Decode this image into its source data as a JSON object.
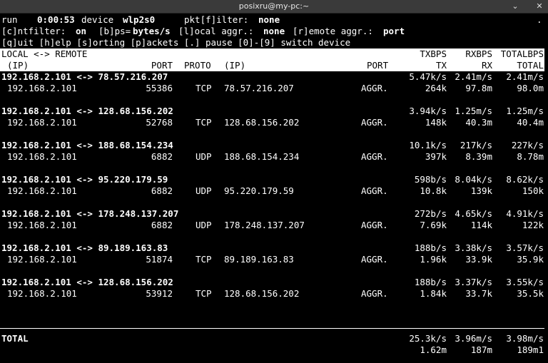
{
  "window": {
    "title": "posixru@my-pc:~",
    "minimize_label": "⌄",
    "close_label": "✕"
  },
  "status": {
    "state": "run",
    "elapsed": "0:00:53",
    "device_label": "device",
    "device": "wlp2s0",
    "pktfilter_label": "pkt[f]ilter:",
    "pktfilter": "none",
    "dot": "."
  },
  "options": {
    "cntfilter_label": "[c]ntfilter:",
    "cntfilter": "on",
    "bps_label": "[b]ps=",
    "bps": "bytes/s",
    "local_aggr_label": "[l]ocal aggr.:",
    "local_aggr": "none",
    "remote_aggr_label": "[r]emote aggr.:",
    "remote_aggr": "port"
  },
  "keys": {
    "help": "[q]uit [h]elp [s]orting [p]ackets [.] pause [0]-[9] switch device"
  },
  "header": {
    "local_remote": "LOCAL <-> REMOTE",
    "txbps": "TXBPS",
    "rxbps": "RXBPS",
    "totalbps": "TOTALBPS",
    "ip_local": "(IP)",
    "port_local": "PORT",
    "proto": "PROTO",
    "ip_remote": "(IP)",
    "port_remote": "PORT",
    "tx": "TX",
    "rx": "RX",
    "total": "TOTAL"
  },
  "connections": [
    {
      "pair": "192.168.2.101 <-> 78.57.216.207",
      "txbps": "5.47k/s",
      "rxbps": "2.41m/s",
      "totalbps": "2.41m/s",
      "local_ip": "192.168.2.101",
      "local_port": "55386",
      "proto": "TCP",
      "remote_ip": "78.57.216.207",
      "remote_port": "AGGR.",
      "tx": "264k",
      "rx": "97.8m",
      "total": "98.0m"
    },
    {
      "pair": "192.168.2.101 <-> 128.68.156.202",
      "txbps": "3.94k/s",
      "rxbps": "1.25m/s",
      "totalbps": "1.25m/s",
      "local_ip": "192.168.2.101",
      "local_port": "52768",
      "proto": "TCP",
      "remote_ip": "128.68.156.202",
      "remote_port": "AGGR.",
      "tx": "148k",
      "rx": "40.3m",
      "total": "40.4m"
    },
    {
      "pair": "192.168.2.101 <-> 188.68.154.234",
      "txbps": "10.1k/s",
      "rxbps": "217k/s",
      "totalbps": "227k/s",
      "local_ip": "192.168.2.101",
      "local_port": "6882",
      "proto": "UDP",
      "remote_ip": "188.68.154.234",
      "remote_port": "AGGR.",
      "tx": "397k",
      "rx": "8.39m",
      "total": "8.78m"
    },
    {
      "pair": "192.168.2.101 <-> 95.220.179.59",
      "txbps": "598b/s",
      "rxbps": "8.04k/s",
      "totalbps": "8.62k/s",
      "local_ip": "192.168.2.101",
      "local_port": "6882",
      "proto": "UDP",
      "remote_ip": "95.220.179.59",
      "remote_port": "AGGR.",
      "tx": "10.8k",
      "rx": "139k",
      "total": "150k"
    },
    {
      "pair": "192.168.2.101 <-> 178.248.137.207",
      "txbps": "272b/s",
      "rxbps": "4.65k/s",
      "totalbps": "4.91k/s",
      "local_ip": "192.168.2.101",
      "local_port": "6882",
      "proto": "UDP",
      "remote_ip": "178.248.137.207",
      "remote_port": "AGGR.",
      "tx": "7.69k",
      "rx": "114k",
      "total": "122k"
    },
    {
      "pair": "192.168.2.101 <-> 89.189.163.83",
      "txbps": "188b/s",
      "rxbps": "3.38k/s",
      "totalbps": "3.57k/s",
      "local_ip": "192.168.2.101",
      "local_port": "51874",
      "proto": "TCP",
      "remote_ip": "89.189.163.83",
      "remote_port": "AGGR.",
      "tx": "1.96k",
      "rx": "33.9k",
      "total": "35.9k"
    },
    {
      "pair": "192.168.2.101 <-> 128.68.156.202",
      "txbps": "188b/s",
      "rxbps": "3.37k/s",
      "totalbps": "3.55k/s",
      "local_ip": "192.168.2.101",
      "local_port": "53912",
      "proto": "TCP",
      "remote_ip": "128.68.156.202",
      "remote_port": "AGGR.",
      "tx": "1.84k",
      "rx": "33.7k",
      "total": "35.5k"
    }
  ],
  "totals": {
    "label": "TOTAL",
    "txbps": "25.3k/s",
    "rxbps": "3.96m/s",
    "totalbps": "3.98m/s",
    "tx": "1.62m",
    "rx": "187m",
    "total": "189m1"
  }
}
